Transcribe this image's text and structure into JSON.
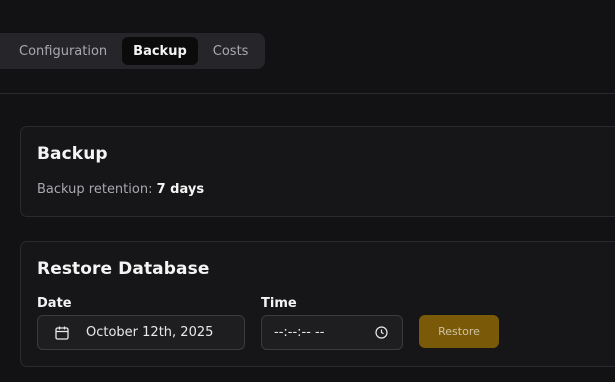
{
  "tabs": [
    {
      "label": "Configuration",
      "active": false
    },
    {
      "label": "Backup",
      "active": true
    },
    {
      "label": "Costs",
      "active": false
    }
  ],
  "backup_card": {
    "title": "Backup",
    "retention_label": "Backup retention:",
    "retention_value": "7 days"
  },
  "restore_card": {
    "title": "Restore Database",
    "date_label": "Date",
    "date_value": "October 12th, 2025",
    "date_icon": "calendar-icon",
    "time_label": "Time",
    "time_value": "--:--:-- --",
    "time_icon": "clock-icon",
    "restore_button": "Restore"
  },
  "colors": {
    "background": "#121214",
    "card": "#161618",
    "accent_button": "#7a5a08"
  }
}
